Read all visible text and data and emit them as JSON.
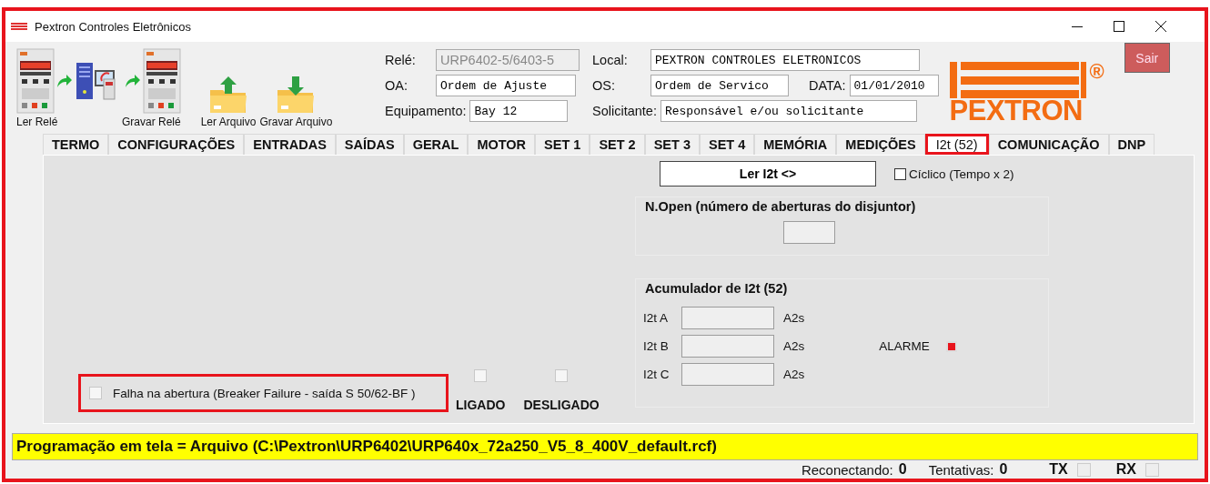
{
  "window": {
    "title": "Pextron Controles Eletrônicos",
    "highlighted": true
  },
  "toolbar": [
    {
      "label": "Ler Relé",
      "kind": "read-relay"
    },
    {
      "label": "Gravar Relé",
      "kind": "write-relay"
    },
    {
      "label": "Ler Arquivo",
      "kind": "open-file"
    },
    {
      "label": "Gravar Arquivo",
      "kind": "save-file"
    }
  ],
  "form": [
    {
      "rows": [
        [
          {
            "label": "Relé:",
            "value": "URP6402-5/6403-5",
            "disabled": true
          }
        ],
        [
          {
            "label": "OA:",
            "value": "Ordem de Ajuste",
            "disabled": false
          }
        ],
        [
          {
            "label": "Equipamento:",
            "value": "Bay 12",
            "disabled": false
          }
        ]
      ]
    },
    {
      "rows": [
        [
          {
            "label": "Local:",
            "value": "PEXTRON CONTROLES ELETRONICOS",
            "disabled": false
          }
        ],
        [
          {
            "label": "OS:",
            "value": "Ordem de Servico",
            "disabled": false
          },
          {
            "label": "DATA:",
            "value": "01/01/2010",
            "disabled": false
          }
        ],
        [
          {
            "label": "Solicitante:",
            "value": "Responsável e/ou solicitante",
            "disabled": false
          }
        ]
      ]
    }
  ],
  "logo": {
    "text": "PEXTRON",
    "mark": "®"
  },
  "exit_button": "Sair",
  "tabs": [
    {
      "label": "TERMO",
      "selected": false,
      "highlighted": false
    },
    {
      "label": "CONFIGURAÇÕES",
      "selected": false,
      "highlighted": false
    },
    {
      "label": "ENTRADAS",
      "selected": false,
      "highlighted": false
    },
    {
      "label": "SAÍDAS",
      "selected": false,
      "highlighted": false
    },
    {
      "label": "GERAL",
      "selected": false,
      "highlighted": false
    },
    {
      "label": "MOTOR",
      "selected": false,
      "highlighted": false
    },
    {
      "label": "SET 1",
      "selected": false,
      "highlighted": false
    },
    {
      "label": "SET 2",
      "selected": false,
      "highlighted": false
    },
    {
      "label": "SET 3",
      "selected": false,
      "highlighted": false
    },
    {
      "label": "SET 4",
      "selected": false,
      "highlighted": false
    },
    {
      "label": "MEMÓRIA",
      "selected": false,
      "highlighted": false
    },
    {
      "label": "MEDIÇÕES",
      "selected": false,
      "highlighted": false
    },
    {
      "label": "I2t (52)",
      "selected": true,
      "highlighted": true
    },
    {
      "label": "COMUNICAÇÃO",
      "selected": false,
      "highlighted": false
    },
    {
      "label": "DNP",
      "selected": false,
      "highlighted": false
    }
  ],
  "read_button": "Ler I2t <>",
  "cyclic": {
    "label": "Cíclico (Tempo x 2)",
    "checked": false
  },
  "nopen": {
    "title": "N.Open (número de aberturas do disjuntor)"
  },
  "accumulator": {
    "title": "Acumulador de I2t (52)",
    "rows": [
      {
        "label": "I2t A",
        "unit": "A2s"
      },
      {
        "label": "I2t B",
        "unit": "A2s"
      },
      {
        "label": "I2t C",
        "unit": "A2s"
      }
    ],
    "alarm": {
      "label": "ALARME",
      "on": true
    }
  },
  "breaker_failure": {
    "label": "Falha na abertura (Breaker Failure - saída S 50/62-BF )",
    "checked": false,
    "highlighted": true
  },
  "state_checks": [
    {
      "label": "LIGADO",
      "checked": false
    },
    {
      "label": "DESLIGADO",
      "checked": false
    }
  ],
  "file_line": "Programação em tela = Arquivo (C:\\Pextron\\URP6402\\URP640x_72a250_V5_8_400V_default.rcf)",
  "status": {
    "reconnect_label": "Reconectando:",
    "reconnect_value": "0",
    "tries_label": "Tentativas:",
    "tries_value": "0",
    "leds": [
      {
        "label": "TX",
        "on": false
      },
      {
        "label": "RX",
        "on": false
      }
    ]
  }
}
